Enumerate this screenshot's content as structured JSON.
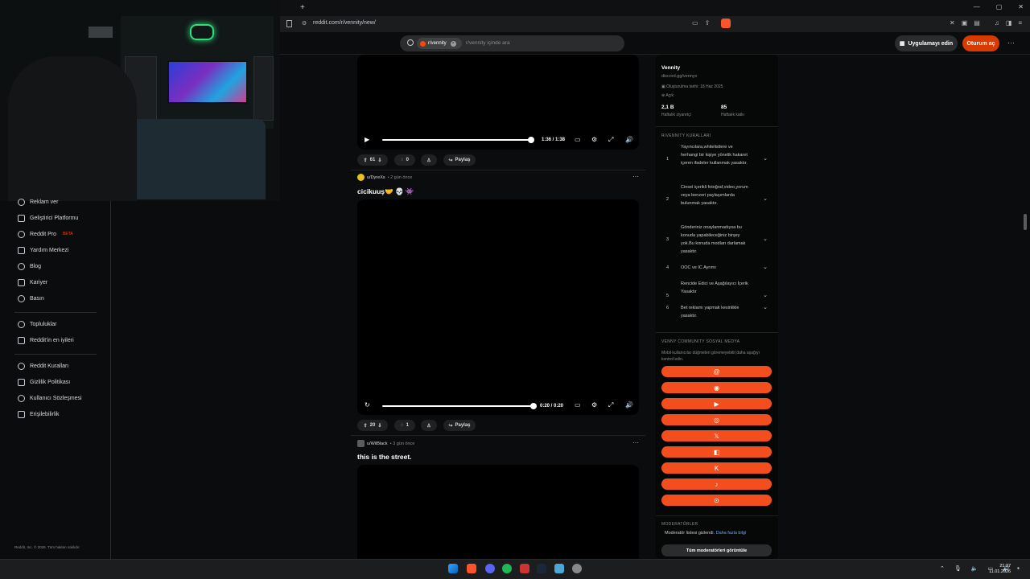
{
  "browser": {
    "url": "reddit.com/r/vennity/new/",
    "new_tab": "+",
    "win_controls": [
      "—",
      "▢",
      "✕"
    ]
  },
  "header": {
    "search_chip": "r/vennity",
    "search_placeholder": "r/vennity içinde ara",
    "get_app_label": "Uygulamayı edin",
    "login_label": "Oturum aç",
    "more": "···"
  },
  "leftnav": {
    "items_top": [
      {
        "label": "Reklam ver",
        "icon": "megaphone-icon"
      },
      {
        "label": "Geliştirici Platformu",
        "icon": "gear-icon"
      },
      {
        "label": "Reddit Pro",
        "icon": "pro-icon",
        "badge": "BETA"
      },
      {
        "label": "Yardım Merkezi",
        "icon": "help-icon"
      },
      {
        "label": "Blog",
        "icon": "book-icon"
      },
      {
        "label": "Kariyer",
        "icon": "briefcase-icon"
      },
      {
        "label": "Basın",
        "icon": "mic-icon"
      }
    ],
    "items_mid": [
      {
        "label": "Topluluklar",
        "icon": "communities-icon"
      },
      {
        "label": "Reddit'in en iyileri",
        "icon": "star-icon"
      }
    ],
    "items_bottom": [
      {
        "label": "Reddit Kuralları",
        "icon": "rules-icon"
      },
      {
        "label": "Gizlilik Politikası",
        "icon": "privacy-icon"
      },
      {
        "label": "Kullanıcı Sözleşmesi",
        "icon": "agreement-icon"
      },
      {
        "label": "Erişilebilirlik",
        "icon": "accessibility-icon"
      }
    ],
    "copyright": "Reddit, Inc. © 2026. Tüm hakları saklıdır."
  },
  "posts": [
    {
      "time": "1:36 / 1:38",
      "progress": 0.98,
      "votes": "61",
      "comments": "0",
      "share": "Paylaş"
    },
    {
      "author": "u/DyreXs",
      "ago": "• 2 gün önce",
      "title": "cicikuuş🤝 💀 👾",
      "time": "0:20 / 0:20",
      "progress": 1.0,
      "votes": "20",
      "comments": "1",
      "share": "Paylaş"
    },
    {
      "author": "u/WilBlack",
      "ago": "• 3 gün önce",
      "title": "this is the street."
    }
  ],
  "sidebar": {
    "name": "Vennity",
    "link": "discord.gg/vennyv",
    "created": "Oluşturulma tarihi: 18 Haz 2025",
    "status": "Açık",
    "stats": [
      {
        "value": "2,1 B",
        "label": "Haftalık ziyaretçi"
      },
      {
        "value": "85",
        "label": "Haftalık katkı"
      }
    ],
    "rules_heading": "R/VENNITY KURALLARI",
    "rules": [
      {
        "num": "1",
        "text": "Yayıncılara,whitelistlere ve herhangi bir kişiye yönelik hakaret içeren ifadeler kullanmak yasaktır."
      },
      {
        "num": "2",
        "text": "Cinsel içerikli fotoğraf,video,yorum veya benzeri paylaşımlarda bulunmak yasaktır."
      },
      {
        "num": "3",
        "text": "Gönderiniz onaylanmadıysa bu konuda yapabileceğiniz birşey yok.Bu konuda modları darlamak yasaktır."
      },
      {
        "num": "4",
        "text": "OOC ve IC Ayrımı"
      },
      {
        "num": "5",
        "text": "Rencide Edici ve Aşağılayıcı İçerik Yasaktır"
      },
      {
        "num": "6",
        "text": "Bet reklamı yapmak kesinlikle yasaktır."
      }
    ],
    "social_heading": "VENNY COMMUNITY SOSYAL MEDYA",
    "social_desc": "Mobil kullanıcılar düğmeleri göremeyebilir;daha aşağıyı kontrol edin.",
    "social_buttons": [
      {
        "icon": "threads-icon",
        "glyph": "@"
      },
      {
        "icon": "discord-icon",
        "glyph": "◉"
      },
      {
        "icon": "youtube-icon",
        "glyph": "▶"
      },
      {
        "icon": "instagram-icon",
        "glyph": "◎"
      },
      {
        "icon": "x-icon",
        "glyph": "𝕏"
      },
      {
        "icon": "twitch-icon",
        "glyph": "◧"
      },
      {
        "icon": "kick-icon",
        "glyph": "K"
      },
      {
        "icon": "tiktok-icon",
        "glyph": "♪"
      },
      {
        "icon": "steam-icon",
        "glyph": "⊙"
      }
    ],
    "mods_heading": "MODERATÖRLER",
    "mods_hidden": "Moderatör listesi gizlendi.",
    "mods_more": "Daha fazla bilgi",
    "mods_button": "Tüm moderatörleri görüntüle"
  },
  "taskbar": {
    "time": "21:27",
    "date": "11.01.2026",
    "colors": {
      "accent": "#ff4500",
      "social": "#f24e1e"
    }
  }
}
